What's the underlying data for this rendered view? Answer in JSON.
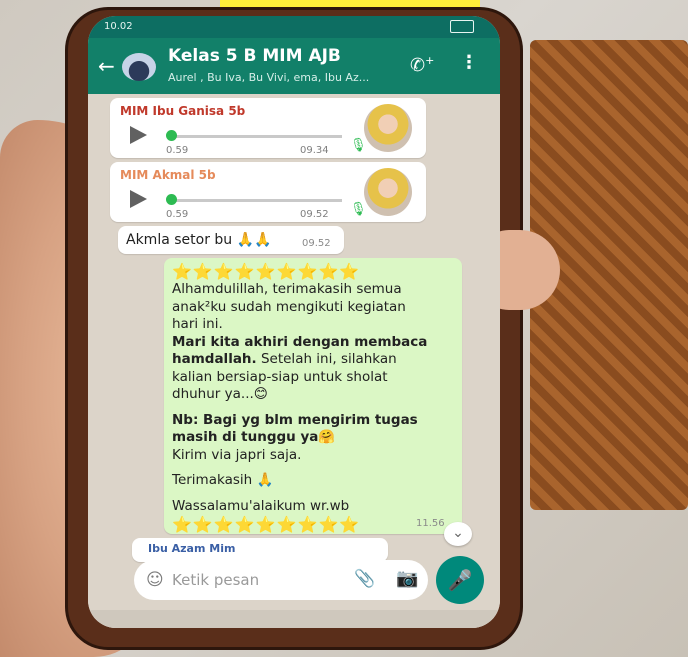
{
  "colors": {
    "header": "#128069",
    "status_bar": "#0d6e62",
    "outgoing_bubble": "#dbf7c5",
    "incoming_bubble": "#ffffff",
    "mic_button": "#00897b",
    "voice_progress": "#2dbb52",
    "star": "#f5c22b"
  },
  "status": {
    "time": "10.02"
  },
  "header": {
    "title": "Kelas 5 B MIM AJB",
    "subtitle": "Aurel , Bu Iva, Bu Vivi, ema, Ibu Az...",
    "back_icon": "arrow-left-icon",
    "call_icon": "add-call-icon",
    "more_icon": "more-vert-icon"
  },
  "messages": [
    {
      "type": "voice",
      "sender": "MIM Ibu Ganisa 5b",
      "sender_color": "#c0392b",
      "duration": "0.59",
      "time": "09.34"
    },
    {
      "type": "voice",
      "sender": "MIM Akmal 5b",
      "sender_color": "#e58a5a",
      "duration": "0.59",
      "time": "09.52"
    },
    {
      "type": "text",
      "text": "Akmla setor bu 🙏🙏",
      "time": "09.52"
    },
    {
      "type": "outgoing",
      "stars_top": "⭐⭐⭐⭐⭐⭐⭐⭐⭐",
      "line1": "Alhamdulillah, terimakasih semua",
      "line2": "anak²ku sudah mengikuti kegiatan",
      "line3": "hari ini.",
      "line4": "Mari kita akhiri dengan membaca",
      "line5_bold": "hamdallah.",
      "line5_rest": " Setelah ini, silahkan",
      "line6": "kalian bersiap-siap untuk sholat",
      "line7": "dhuhur ya...😊",
      "line8": "Nb: Bagi yg blm mengirim tugas",
      "line9": "masih di tunggu ya🤗",
      "line10": "Kirim via japri saja.",
      "line11": "Terimakasih 🙏",
      "line12": "Wassalamu'alaikum wr.wb",
      "stars_bottom": "⭐⭐⭐⭐⭐⭐⭐⭐⭐",
      "time": "11.56"
    },
    {
      "type": "partial",
      "sender": "Ibu Azam Mim"
    }
  ],
  "composer": {
    "placeholder": "Ketik pesan",
    "emoji_icon": "emoji-icon",
    "attach_icon": "paperclip-icon",
    "camera_icon": "camera-icon",
    "mic_icon": "microphone-icon"
  }
}
